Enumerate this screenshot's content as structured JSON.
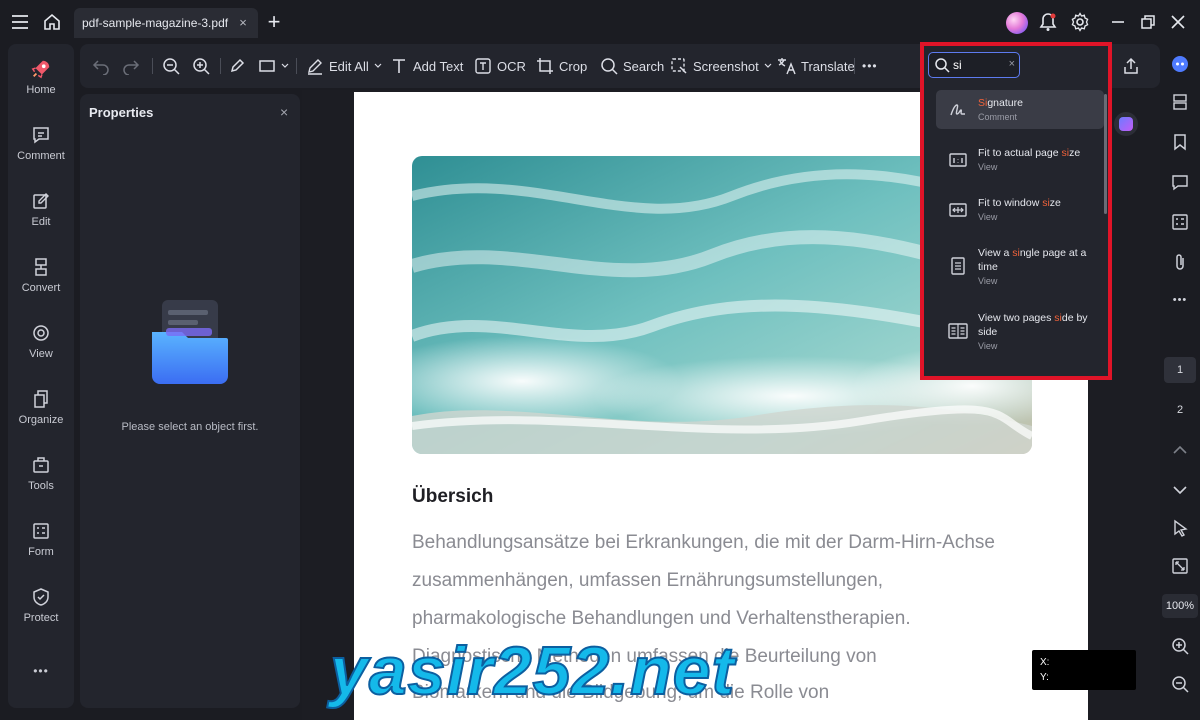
{
  "window": {
    "tab_title": "pdf-sample-magazine-3.pdf",
    "tab_close": "×",
    "new_tab": "+"
  },
  "left_rail": {
    "items": [
      {
        "label": "Home",
        "icon": "home-rocket-icon"
      },
      {
        "label": "Comment",
        "icon": "comment-icon"
      },
      {
        "label": "Edit",
        "icon": "edit-icon"
      },
      {
        "label": "Convert",
        "icon": "convert-icon"
      },
      {
        "label": "View",
        "icon": "view-icon"
      },
      {
        "label": "Organize",
        "icon": "organize-icon"
      },
      {
        "label": "Tools",
        "icon": "tools-icon"
      },
      {
        "label": "Form",
        "icon": "form-icon"
      },
      {
        "label": "Protect",
        "icon": "protect-icon"
      }
    ],
    "more": "•••"
  },
  "toolbar": {
    "edit_all": "Edit All",
    "add_text": "Add Text",
    "ocr": "OCR",
    "crop": "Crop",
    "search": "Search",
    "screenshot": "Screenshot",
    "translate": "Translate",
    "more": "•••"
  },
  "properties": {
    "title": "Properties",
    "close": "×",
    "empty_message": "Please select an object first."
  },
  "document": {
    "heading": "Übersich",
    "lines": [
      "Behandlungsansätze bei Erkrankungen, die mit der Darm-Hirn-Achse",
      "zusammenhängen, umfassen Ernährungsumstellungen,",
      "pharmakologische Behandlungen und Verhaltenstherapien.",
      "Diagnostische Methoden umfassen die Beurteilung von",
      "Biomarkern und die Bildgebung, um die Rolle von"
    ]
  },
  "search_popup": {
    "query": "si",
    "clear": "×",
    "results": [
      {
        "pre": "",
        "hl": "Si",
        "post": "gnature",
        "category": "Comment",
        "icon": "signature-icon",
        "active": true
      },
      {
        "pre": "Fit to actual page ",
        "hl": "si",
        "post": "ze",
        "category": "View",
        "icon": "actual-size-icon",
        "active": false
      },
      {
        "pre": "Fit to window ",
        "hl": "si",
        "post": "ze",
        "category": "View",
        "icon": "fit-window-icon",
        "active": false
      },
      {
        "pre": "View a ",
        "hl": "si",
        "post": "ngle page at a time",
        "category": "View",
        "icon": "single-page-icon",
        "active": false
      },
      {
        "pre": "View two pages ",
        "hl": "si",
        "post": "de by side",
        "category": "View",
        "icon": "two-page-icon",
        "active": false
      }
    ]
  },
  "right_rail": {
    "pages": [
      "1",
      "2"
    ],
    "zoom": "100%",
    "more": "•••"
  },
  "coords": {
    "x_label": "X:",
    "y_label": "Y:"
  },
  "watermark": "yasir252.net",
  "colors": {
    "accent_highlight": "#f0623a",
    "popup_border": "#e01428",
    "background": "#1b1c22",
    "panel": "#23252d"
  }
}
